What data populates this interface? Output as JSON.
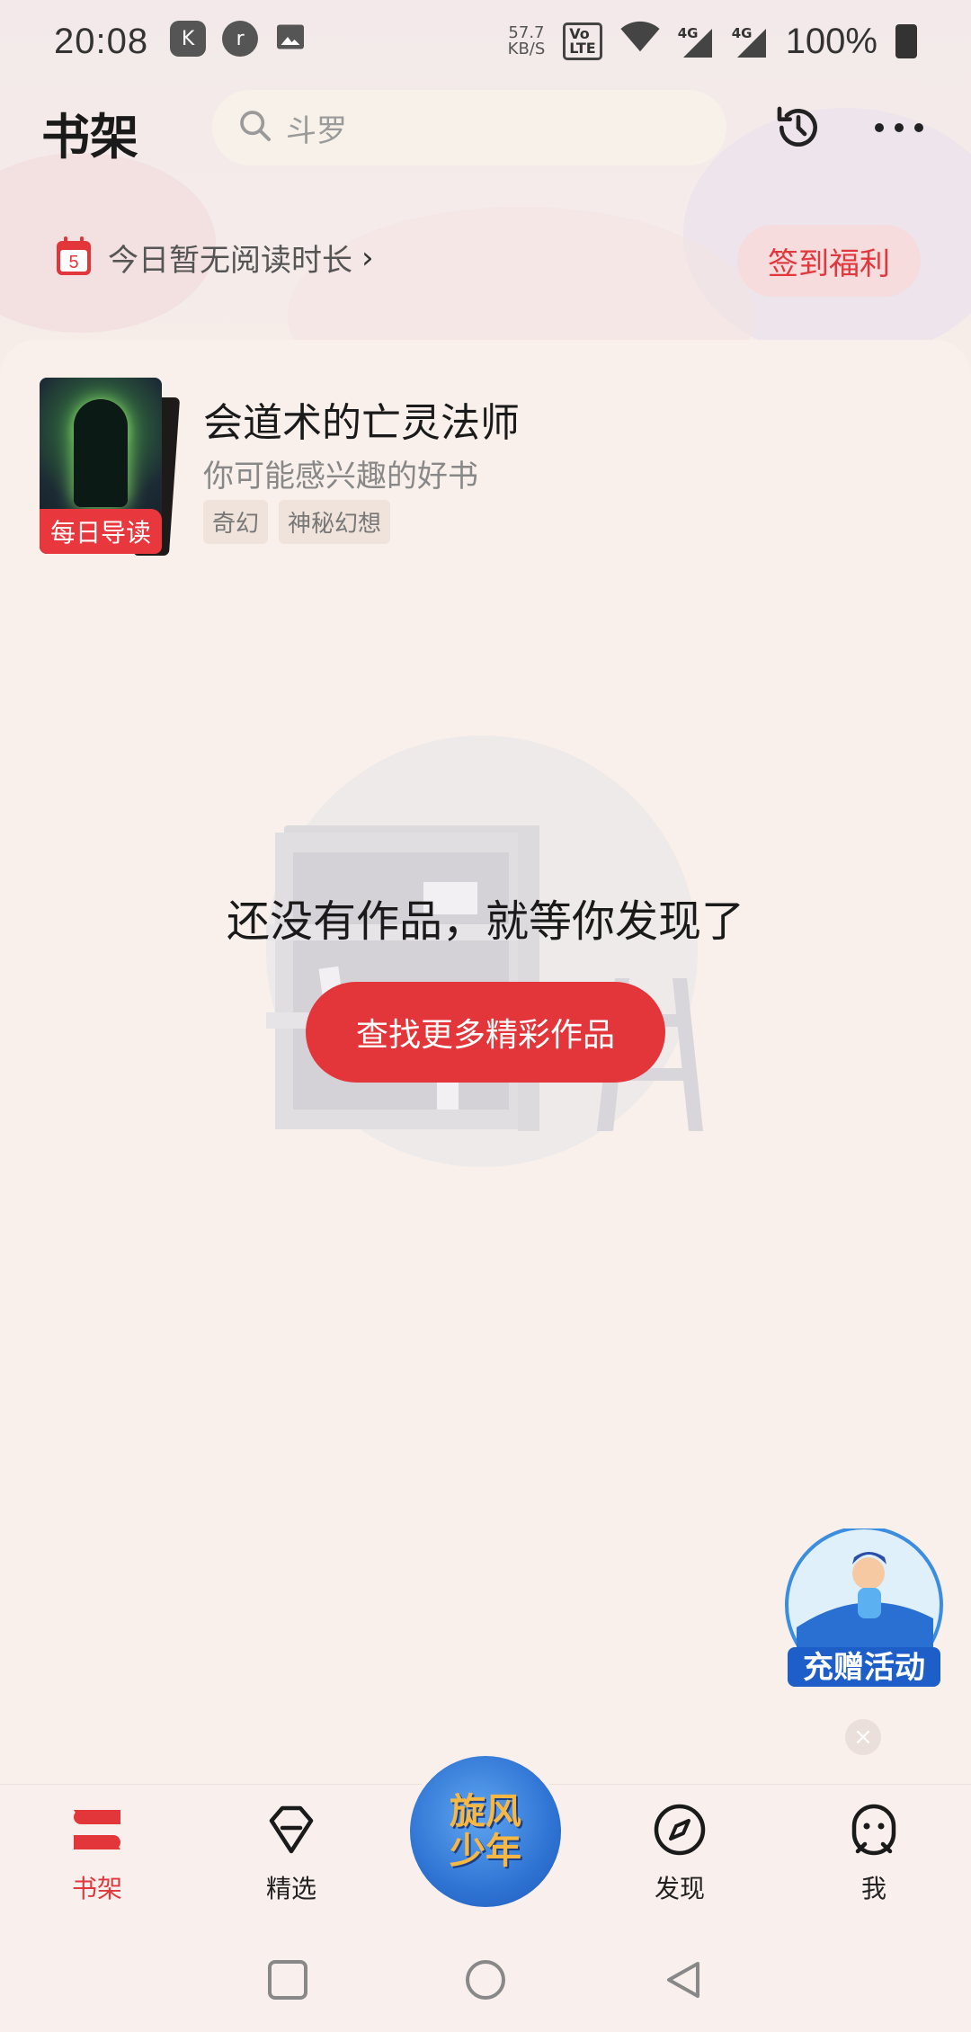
{
  "status_bar": {
    "time": "20:08",
    "net_speed_value": "57.7",
    "net_speed_unit": "KB/S",
    "volte_top": "Vo",
    "volte_bottom": "LTE",
    "sim1_label": "4G",
    "sim2_label": "4G",
    "battery": "100%"
  },
  "header": {
    "title": "书架",
    "search_placeholder": "斗罗"
  },
  "reading": {
    "calendar_day": "5",
    "text": "今日暂无阅读时长",
    "chevron": "›",
    "signin_label": "签到福利"
  },
  "recommendation": {
    "badge": "每日导读",
    "title": "会道术的亡灵法师",
    "subtitle": "你可能感兴趣的好书",
    "tags": [
      "奇幻",
      "神秘幻想"
    ]
  },
  "empty_state": {
    "message": "还没有作品，就等你发现了",
    "button": "查找更多精彩作品"
  },
  "promo": {
    "label": "充赠活动",
    "close": "×"
  },
  "bottom_nav": {
    "items": [
      {
        "label": "书架",
        "icon": "bookshelf-icon",
        "active": true
      },
      {
        "label": "精选",
        "icon": "diamond-icon",
        "active": false
      },
      {
        "label": "旋风少年",
        "icon": "center-promo-icon",
        "active": false
      },
      {
        "label": "发现",
        "icon": "compass-icon",
        "active": false
      },
      {
        "label": "我",
        "icon": "profile-icon",
        "active": false
      }
    ],
    "center_line1": "旋风",
    "center_line2": "少年"
  },
  "colors": {
    "accent": "#e3363b",
    "background": "#f9f0eb",
    "signin_bg": "#f6dcdc"
  }
}
